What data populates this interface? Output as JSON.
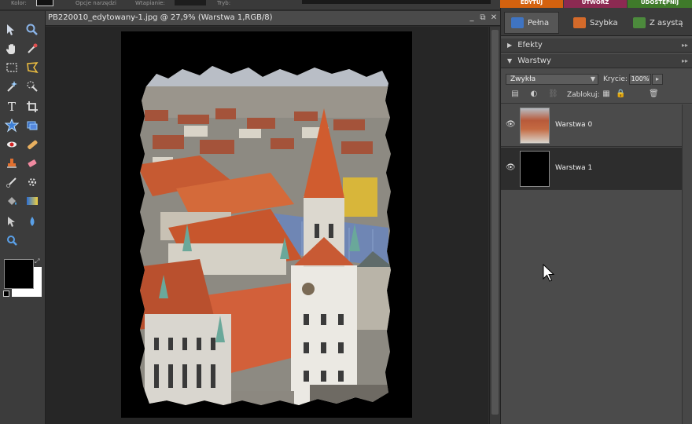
{
  "top_bar": {
    "partial_labels": [
      "Kolor:",
      "Opcje narzędzi",
      "Wtapianie:",
      "Tryb:"
    ],
    "mode_tabs": [
      {
        "label": "EDYTUJ",
        "color": "#d4620f"
      },
      {
        "label": "UTWÓRZ",
        "color": "#8c2a52"
      },
      {
        "label": "UDOSTĘPNIJ",
        "color": "#3f7a2a"
      }
    ]
  },
  "toolbox": {
    "tools": [
      "move-tool",
      "zoom-tool",
      "hand-tool",
      "eyedropper-tool",
      "marquee-tool",
      "lasso-tool",
      "magic-wand-tool",
      "quick-selection-tool",
      "type-tool",
      "crop-tool",
      "cookie-cutter-tool",
      "straighten-tool",
      "red-eye-tool",
      "healing-brush-tool",
      "clone-stamp-tool",
      "eraser-tool",
      "brush-tool",
      "smart-brush-tool",
      "paint-bucket-tool",
      "gradient-tool",
      "custom-shape-tool",
      "blur-tool",
      "sponge-tool"
    ],
    "foreground_color": "#000000",
    "background_color": "#ffffff"
  },
  "document": {
    "title": "PB220010_edytowany-1.jpg @ 27,9% (Warstwa 1,RGB/8)"
  },
  "panel_bin": {
    "edit_tabs": [
      "Pełna",
      "Szybka",
      "Z asystą"
    ],
    "effects_label": "Efekty",
    "layers_label": "Warstwy",
    "blend_mode": "Zwykła",
    "opacity_label": "Krycie:",
    "opacity_value": "100%",
    "lock_label": "Zablokuj:",
    "layers": [
      {
        "name": "Warstwa 0",
        "visible": true,
        "selected": false
      },
      {
        "name": "Warstwa 1",
        "visible": true,
        "selected": true
      }
    ]
  }
}
